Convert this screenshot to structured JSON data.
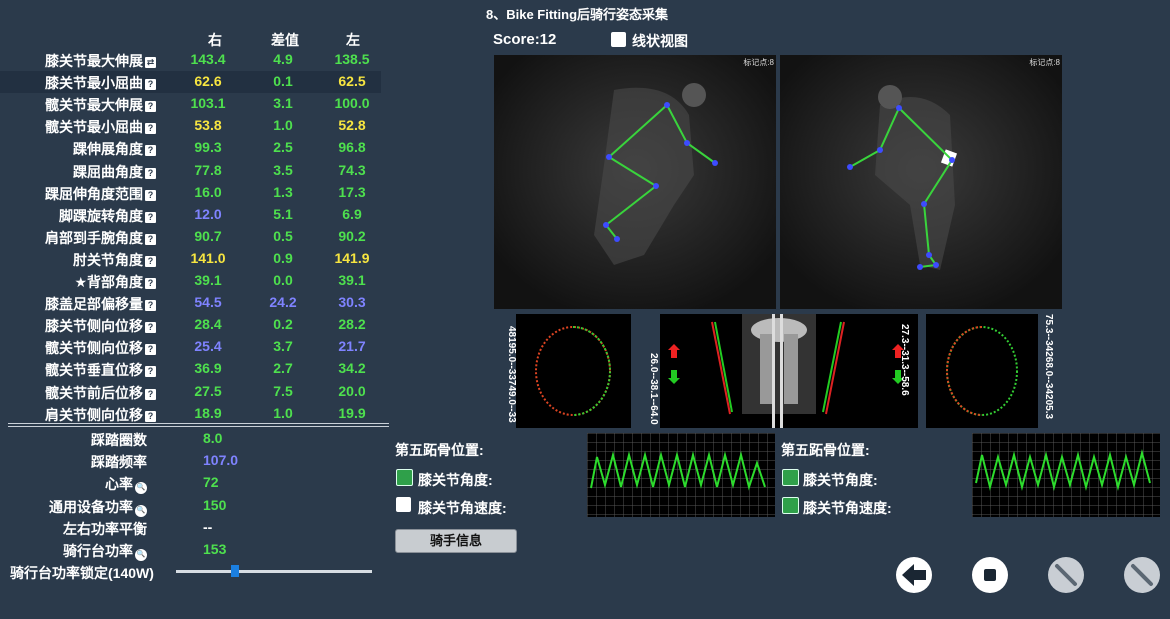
{
  "title": "8、Bike Fitting后骑行姿态采集",
  "columns": {
    "right": "右",
    "diff": "差值",
    "left": "左"
  },
  "metrics": [
    {
      "label": "膝关节最大伸展",
      "right": "143.4",
      "diff": "4.9",
      "left": "138.5",
      "colors": [
        "g",
        "g",
        "g"
      ],
      "icon": "⇄"
    },
    {
      "label": "膝关节最小屈曲",
      "right": "62.6",
      "diff": "0.1",
      "left": "62.5",
      "colors": [
        "y",
        "g",
        "y"
      ],
      "selected": true
    },
    {
      "label": "髋关节最大伸展",
      "right": "103.1",
      "diff": "3.1",
      "left": "100.0",
      "colors": [
        "g",
        "g",
        "g"
      ]
    },
    {
      "label": "髋关节最小屈曲",
      "right": "53.8",
      "diff": "1.0",
      "left": "52.8",
      "colors": [
        "y",
        "g",
        "y"
      ]
    },
    {
      "label": "踝伸展角度",
      "right": "99.3",
      "diff": "2.5",
      "left": "96.8",
      "colors": [
        "g",
        "g",
        "g"
      ]
    },
    {
      "label": "踝屈曲角度",
      "right": "77.8",
      "diff": "3.5",
      "left": "74.3",
      "colors": [
        "g",
        "g",
        "g"
      ]
    },
    {
      "label": "踝屈伸角度范围",
      "right": "16.0",
      "diff": "1.3",
      "left": "17.3",
      "colors": [
        "g",
        "g",
        "g"
      ]
    },
    {
      "label": "脚踝旋转角度",
      "right": "12.0",
      "diff": "5.1",
      "left": "6.9",
      "colors": [
        "b",
        "g",
        "g"
      ]
    },
    {
      "label": "肩部到手腕角度",
      "right": "90.7",
      "diff": "0.5",
      "left": "90.2",
      "colors": [
        "g",
        "g",
        "g"
      ]
    },
    {
      "label": "肘关节角度",
      "right": "141.0",
      "diff": "0.9",
      "left": "141.9",
      "colors": [
        "y",
        "g",
        "y"
      ]
    },
    {
      "label": "★背部角度",
      "right": "39.1",
      "diff": "0.0",
      "left": "39.1",
      "colors": [
        "g",
        "g",
        "g"
      ]
    },
    {
      "label": "膝盖足部偏移量",
      "right": "54.5",
      "diff": "24.2",
      "left": "30.3",
      "colors": [
        "b",
        "b",
        "b"
      ]
    },
    {
      "label": "膝关节侧向位移",
      "right": "28.4",
      "diff": "0.2",
      "left": "28.2",
      "colors": [
        "g",
        "g",
        "g"
      ]
    },
    {
      "label": "髋关节侧向位移",
      "right": "25.4",
      "diff": "3.7",
      "left": "21.7",
      "colors": [
        "b",
        "g",
        "b"
      ]
    },
    {
      "label": "髋关节垂直位移",
      "right": "36.9",
      "diff": "2.7",
      "left": "34.2",
      "colors": [
        "g",
        "g",
        "g"
      ]
    },
    {
      "label": "髋关节前后位移",
      "right": "27.5",
      "diff": "7.5",
      "left": "20.0",
      "colors": [
        "g",
        "g",
        "g"
      ]
    },
    {
      "label": "肩关节侧向位移",
      "right": "18.9",
      "diff": "1.0",
      "left": "19.9",
      "colors": [
        "g",
        "g",
        "g"
      ]
    }
  ],
  "stats": [
    {
      "label": "踩踏圈数",
      "value": "8.0",
      "color": "g"
    },
    {
      "label": "踩踏频率",
      "value": "107.0",
      "color": "b"
    },
    {
      "label": "心率",
      "value": "72",
      "color": "g",
      "mag": true
    },
    {
      "label": "通用设备功率",
      "value": "150",
      "color": "g",
      "mag": true
    },
    {
      "label": "左右功率平衡",
      "value": "--",
      "color": "w"
    },
    {
      "label": "骑行台功率",
      "value": "153",
      "color": "g",
      "mag": true
    }
  ],
  "slider": {
    "label": "骑行台功率锁定(140W)",
    "value_fraction": 0.29,
    "accent": "#1b7fe0"
  },
  "score": "Score:12",
  "line_view_label": "线状视图",
  "marker_left": "标记点:8",
  "marker_right": "标记点:8",
  "trace_labels": [
    "48195.0--33749.0--33",
    "26.0--38.1--64.0",
    "27.3--31.3--58.6",
    "75.3--34268.0--34205.3"
  ],
  "fifth_left": {
    "title": "第五跖骨位置:",
    "knee_angle": "膝关节角度:",
    "knee_speed": "膝关节角速度:"
  },
  "fifth_right": {
    "title": "第五跖骨位置:",
    "knee_angle": "膝关节角度:",
    "knee_speed": "膝关节角速度:"
  },
  "rider_button": "骑手信息",
  "icons": [
    "back-arrow-icon",
    "stop-icon",
    "disabled-icon",
    "disabled-icon"
  ]
}
